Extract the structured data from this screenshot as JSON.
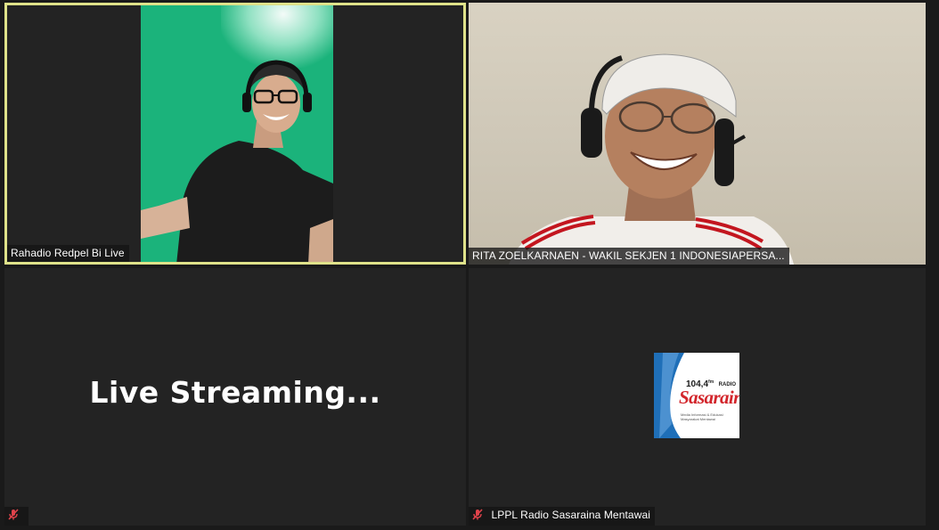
{
  "participants": [
    {
      "name": "Rahadio Redpel Bi Live",
      "active_speaker": true,
      "muted": false,
      "type": "video"
    },
    {
      "name": "RITA ZOELKARNAEN - WAKIL SEKJEN 1 INDONESIAPERSA...",
      "active_speaker": false,
      "muted": false,
      "type": "video"
    },
    {
      "name": "",
      "active_speaker": false,
      "muted": true,
      "type": "text",
      "display_text": "Live  Streaming..."
    },
    {
      "name": "LPPL Radio Sasaraina Mentawai",
      "active_speaker": false,
      "muted": true,
      "type": "logo",
      "logo": {
        "freq": "104,4",
        "freq_unit": "fm",
        "radio": "RADIO",
        "brand": "Sasaraina",
        "tagline": "Media Informasi & Edukasi Masyarakat Mentawai"
      }
    }
  ],
  "colors": {
    "active_speaker_border": "#dfe28a",
    "muted_icon": "#e0434b",
    "tile_background": "#232323",
    "brand_red": "#d2252b",
    "brand_blue": "#1f6fb8"
  }
}
